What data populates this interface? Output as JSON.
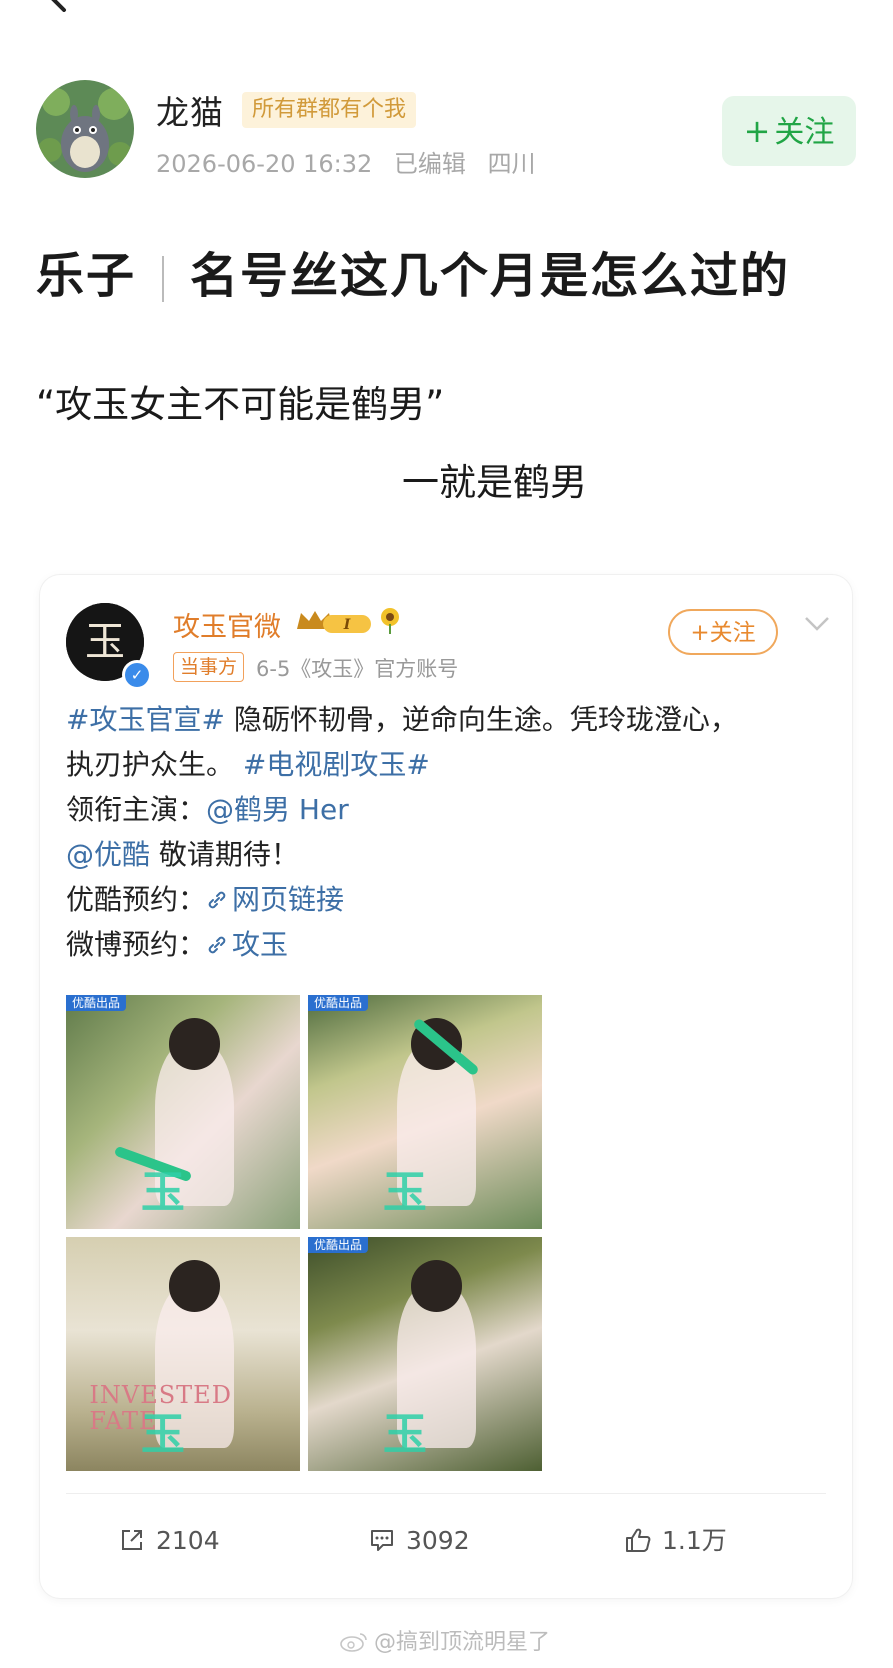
{
  "author": {
    "name": "龙猫",
    "badge": "所有群都有个我",
    "date": "2026-06-20 16:32",
    "edited": "已编辑",
    "location": "四川",
    "follow_label": "关注"
  },
  "post": {
    "title_tag": "乐子",
    "title_text": "名号丝这几个月是怎么过的",
    "quote": "“攻玉女主不可能是鹤男”",
    "reply": "一就是鹤男"
  },
  "repost": {
    "name": "攻玉官微",
    "crown_level": "I",
    "party_badge": "当事方",
    "meta": "6-5《攻玉》官方账号",
    "follow_label": "+关注",
    "line1": {
      "tag": "#攻玉官宣#",
      "text": "隐砺怀韧骨，逆命向生途。凭玲珑澄心，"
    },
    "line2": {
      "text": "执刃护众生。",
      "tag": "#电视剧攻玉#"
    },
    "line3": {
      "label": "领衔主演：",
      "mention": "@鹤男 Her"
    },
    "line4": {
      "mention": "@优酷",
      "text": "敬请期待！"
    },
    "line5": {
      "label": "优酷预约：",
      "link": "网页链接"
    },
    "line6": {
      "label": "微博预约：",
      "link": "攻玉"
    },
    "images": [
      {
        "tag": "优酷出品",
        "logo": "玉"
      },
      {
        "tag": "优酷出品",
        "logo": "玉"
      },
      {
        "caption": "INVESTED FATE",
        "logo": "玉"
      },
      {
        "tag": "优酷出品",
        "logo": "玉"
      }
    ],
    "actions": {
      "share": "2104",
      "comment": "3092",
      "like": "1.1万"
    }
  },
  "watermark": "@搞到顶流明星了",
  "colors": {
    "follow_green": "#21a546",
    "follow_orange": "#e8892e",
    "topic_blue": "#3d6fa6",
    "badge_gold": "#d19a3a"
  }
}
